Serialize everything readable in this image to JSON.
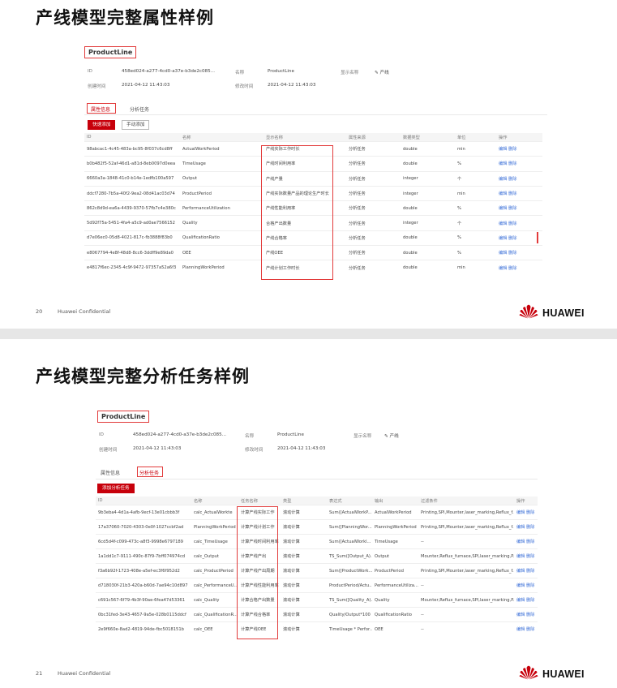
{
  "slides": [
    {
      "title": "产线模型完整属性样例",
      "tag": "ProductLine",
      "meta": {
        "id_label": "ID",
        "id_value": "458ed024-a277-4cd0-a37e-b3de2c085...",
        "name_label": "名称",
        "name_value": "ProductLine",
        "display_label": "显示名称",
        "display_value": "产线",
        "created_label": "创建时间",
        "created_value": "2021-04-12 11:43:03",
        "modified_label": "修改时间",
        "modified_value": "2021-04-12 11:43:03"
      },
      "tabs": [
        "属性信息",
        "分析任务"
      ],
      "buttons": [
        "快速添加",
        "手动添加"
      ],
      "columns": [
        "ID",
        "名称",
        "显示名称",
        "属性来源",
        "数据类型",
        "单位",
        "操作"
      ],
      "rows": [
        [
          "98abcac1-4c45-483a-bc95-8f037c6cd8ff",
          "ActualWorkPeriod",
          "产线实际工作时长",
          "分析任务",
          "double",
          "min",
          "编辑  删除"
        ],
        [
          "b0b482f5-52af-46d1-a81d-8eb0097d0eea",
          "TimeUsage",
          "产线时间利用率",
          "分析任务",
          "double",
          "%",
          "编辑  删除"
        ],
        [
          "6660a3a-1848-41c0-b14e-1edfb100a597",
          "Output",
          "产线产量",
          "分析任务",
          "integer",
          "个",
          "编辑  删除"
        ],
        [
          "ddcf7280-7b5a-40f2-9ea2-08d41ac03d74",
          "ProductPeriod",
          "产线实际数量产品的理论生产时长",
          "分析任务",
          "integer",
          "min",
          "编辑  删除"
        ],
        [
          "862c8d9d-ea6a-4439-9370-57fb7c4e380c",
          "PerformanceUtilization",
          "产线性能利用率",
          "分析任务",
          "double",
          "%",
          "编辑  删除"
        ],
        [
          "5d92f75a-5451-4fa4-a5c9-ad0ae7566152",
          "Quality",
          "合格产出数量",
          "分析任务",
          "integer",
          "个",
          "编辑  删除"
        ],
        [
          "d7e06ec0-05d8-4021-817c-fb3888f83b0",
          "QualificationRatio",
          "产线合格率",
          "分析任务",
          "double",
          "%",
          "编辑  删除"
        ],
        [
          "e8067794-4e8f-48d8-8cc6-3ddff9e89da0",
          "OEE",
          "产线OEE",
          "分析任务",
          "double",
          "%",
          "编辑  删除"
        ],
        [
          "e4817f6ec-2345-4c9f-9472-97357a52a6f3",
          "PlanningWorkPeriod",
          "产线计划工作时长",
          "分析任务",
          "double",
          "min",
          "编辑  删除"
        ]
      ],
      "page_number": "20",
      "confidential": "Huawei Confidential",
      "logo": "HUAWEI"
    },
    {
      "title": "产线模型完整分析任务样例",
      "tag": "ProductLine",
      "meta": {
        "id_label": "ID",
        "id_value": "458ed024-a277-4cd0-a37e-b3de2c085...",
        "name_label": "名称",
        "name_value": "ProductLine",
        "display_label": "显示名称",
        "display_value": "产线",
        "created_label": "创建时间",
        "created_value": "2021-04-12 11:43:03",
        "modified_label": "修改时间",
        "modified_value": "2021-04-12 11:43:03"
      },
      "tabs": [
        "属性信息",
        "分析任务"
      ],
      "buttons": [
        "添加分析任务"
      ],
      "columns": [
        "ID",
        "名称",
        "任务名称",
        "类型",
        "表达式",
        "输出",
        "过滤条件",
        "操作"
      ],
      "rows": [
        [
          "9b3eba4-4d1a-4afb-9ecf-13e01cbbb3f",
          "calc_ActualWorkte",
          "计算产线实际工作",
          "滚动计算",
          "Sum([ActualWorkP...",
          "ActualWorkPeriod",
          "Printing,SPI,Mounter,laser_marking,Reflux_f...",
          "编辑  删除"
        ],
        [
          "17a37060-7020-4303-0e0f-1027ccbf2ad",
          "PlanningWorkPeriod",
          "计算产线计划工作",
          "滚动计算",
          "Sum([PlanningWor...",
          "PlanningWorkPeriod",
          "Printing,SPI,Mounter,laser_marking,Reflux_f...",
          "编辑  删除"
        ],
        [
          "6cd5d4f-c099-473c-a8f3-9998e6797189",
          "calc_TimeUsage",
          "计算产线时间利用率",
          "滚动计算",
          "Sum([ActualWorkl...",
          "TimeUsage",
          "--",
          "编辑  删除"
        ],
        [
          "1a1dd1c7-9111-490c-87f9-7bff074974cd",
          "calc_Output",
          "计算产线产出",
          "滚动计算",
          "TS_Sum([Output_A)...",
          "Output",
          "Mounter,Reflux_furnace,SPI,laser_marking,P...",
          "编辑  删除"
        ],
        [
          "f3a6b92f-1723-408e-a5ef-ec3f6f952d2",
          "calc_ProductPeriod",
          "计算产线产出周期",
          "滚动计算",
          "Sum([ProductWork...",
          "ProductPeriod",
          "Printing,SPI,Mounter,laser_marking,Reflux_f...",
          "编辑  删除"
        ],
        [
          "d718030f-21b3-420a-b60d-7ae94c10d897",
          "calc_PerformanceU...",
          "计算产线性能利用率",
          "滚动计算",
          "ProductPeriod/Actu...",
          "PerformanceUtiliza...",
          "--",
          "编辑  删除"
        ],
        [
          "c691c567-6f79-4b3f-90ae-6fea47d53361",
          "calc_Quality",
          "计算合格产出数量",
          "滚动计算",
          "TS_Sum([Quality_A)...",
          "Quality",
          "Mounter,Reflux_furnace,SPI,laser_marking,P...",
          "编辑  删除"
        ],
        [
          "0bc31fed-3e43-4657-9a5e-028b0115ddcf",
          "calc_QualificationR...",
          "计算产线合格率",
          "滚动计算",
          "Quality/Output*100",
          "QualificationRatio",
          "--",
          "编辑  删除"
        ],
        [
          "2e9f660e-8ad2-4819-94de-fbc5018151b",
          "calc_OEE",
          "计算产线OEE",
          "滚动计算",
          "TimeUsage * Perfor...",
          "OEE",
          "--",
          "编辑  删除"
        ]
      ],
      "page_number": "21",
      "confidential": "Huawei Confidential",
      "logo": "HUAWEI"
    }
  ]
}
